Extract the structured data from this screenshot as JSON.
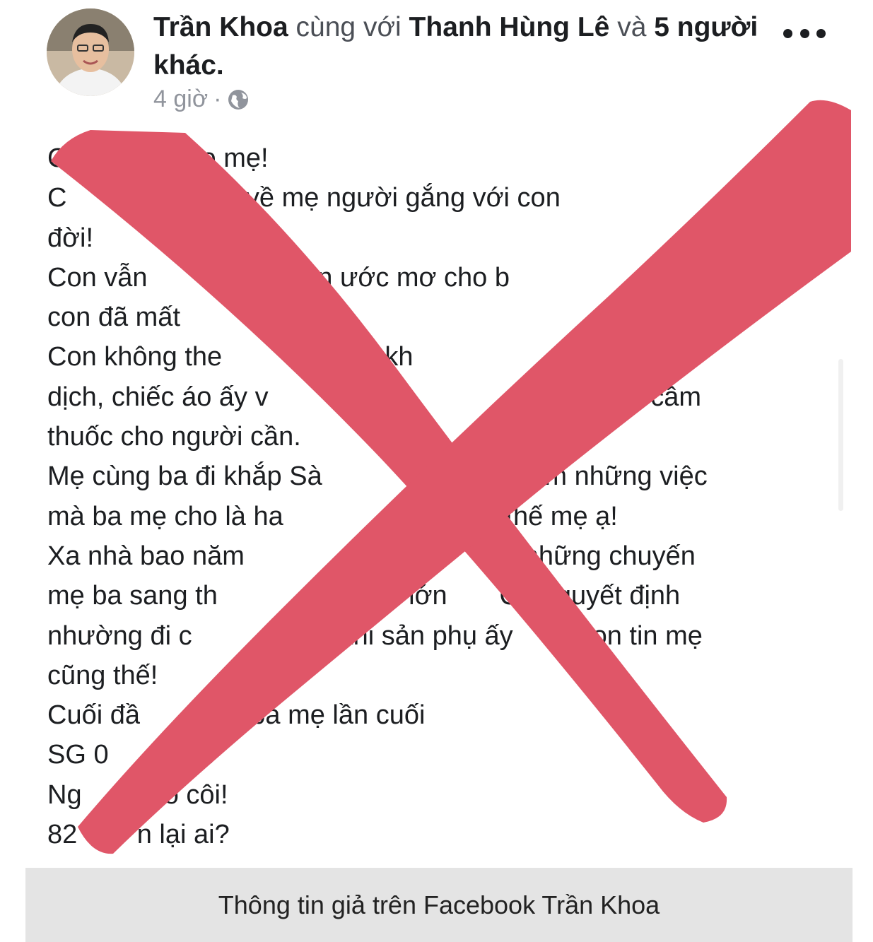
{
  "post": {
    "author": "Trần Khoa",
    "with_word": "cùng với",
    "tagged": "Thanh Hùng Lê",
    "and_word": "và",
    "others": "5 người khác.",
    "time": "4 giờ",
    "separator": "·",
    "privacy_icon": "globe-icon",
    "more_icon": "more-options-icon",
    "lines": [
      "Chà            ào mẹ!",
      "C               ề ba, về mẹ người gắng với con",
      "đời!",
      "Con vẫn                 ẽ lên ước mơ cho b",
      "con đã mất",
      "Con không the              phải kh                   vào tâm",
      "dịch, chiếc áo ấy v               b                 khi ấy vẫn cầm",
      "thuốc cho người cần.",
      "Mẹ cùng ba đi khắp Sà                 ng ba làm những việc",
      "mà ba mẹ cho là ha                     cũng thế mẹ ạ!",
      "Xa nhà bao năm             u con          ỉ là những chuyến",
      "mẹ ba sang th           n yêu ấy lớn       Con quyết định",
      "nhường đi c            máy khi sản phụ ấy        Con tin mẹ",
      "cũng thế!",
      "Cuối đầ        biệt ba mẹ lần cuối",
      "SG 0          21",
      "Ng        mồ côi!",
      "82        n lại ai?"
    ]
  },
  "overlay": {
    "color": "#e05668",
    "meaning": "cross-mark"
  },
  "caption": "Thông tin giả trên Facebook Trần Khoa"
}
